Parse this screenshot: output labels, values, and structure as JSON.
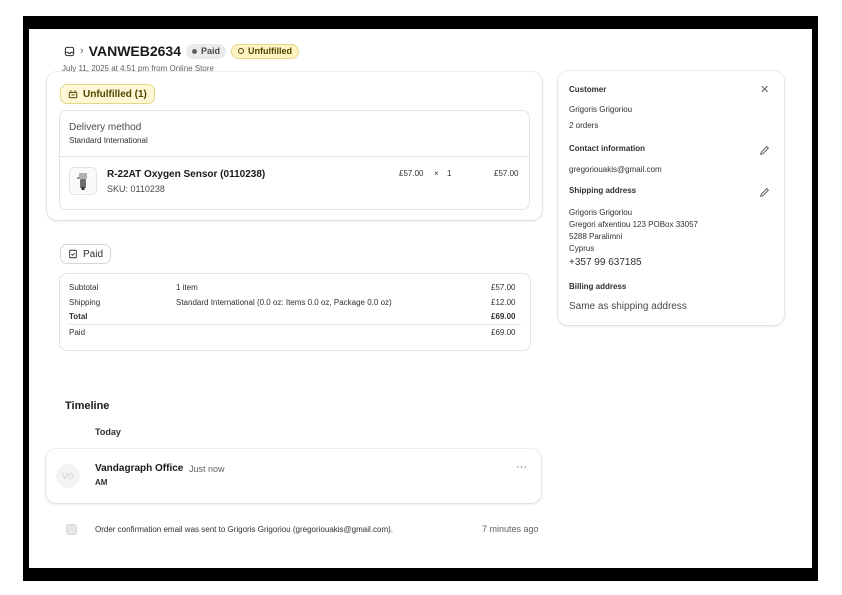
{
  "header": {
    "order_number": "VANWEB2634",
    "separator": "›",
    "paid_badge": "Paid",
    "unfulfilled_badge": "Unfulfilled",
    "subtitle": "July 11, 2025 at 4:51 pm from Online Store"
  },
  "fulfillment": {
    "status_label": "Unfulfilled (1)",
    "delivery_method_label": "Delivery method",
    "delivery_method_value": "Standard International",
    "item": {
      "name": "R-22AT Oxygen Sensor (0110238)",
      "sku": "SKU: 0110238",
      "unit_price": "£57.00",
      "multiply": "×",
      "quantity": "1",
      "total": "£57.00"
    }
  },
  "payment": {
    "status_label": "Paid",
    "rows": [
      {
        "label": "Subtotal",
        "detail": "1 item",
        "amount": "£57.00"
      },
      {
        "label": "Shipping",
        "detail": "Standard International (0.0 oz: Items 0.0 oz, Package 0.0 oz)",
        "amount": "£12.00"
      },
      {
        "label": "Total",
        "detail": "",
        "amount": "£69.00"
      },
      {
        "label": "Paid",
        "detail": "",
        "amount": "£69.00"
      }
    ]
  },
  "timeline": {
    "title": "Timeline",
    "day_label": "Today",
    "comment": {
      "avatar_initials": "VO",
      "author": "Vandagraph Office",
      "time": "Just now",
      "body": "AM",
      "more": "···"
    },
    "event": {
      "text": "Order confirmation email was sent to Grigoris Grigoriou (gregoriouakis@gmail.com).",
      "time": "7 minutes ago"
    }
  },
  "customer": {
    "section_title": "Customer",
    "name": "Grigoris Grigoriou",
    "orders": "2 orders",
    "contact_title": "Contact information",
    "email": "gregoriouakis@gmail.com",
    "shipping_title": "Shipping address",
    "address_lines": [
      "Grigoris Grigoriou",
      "Gregori afxentiou 123 POBox 33057",
      "5288 Paralimni",
      "Cyprus"
    ],
    "phone": "+357 99 637185",
    "billing_title": "Billing address",
    "billing_value": "Same as shipping address"
  },
  "icons": {
    "order": "inbox-icon",
    "close": "close-icon",
    "edit": "pencil-icon",
    "fulfill": "package-icon",
    "paid": "receipt-check-icon"
  }
}
